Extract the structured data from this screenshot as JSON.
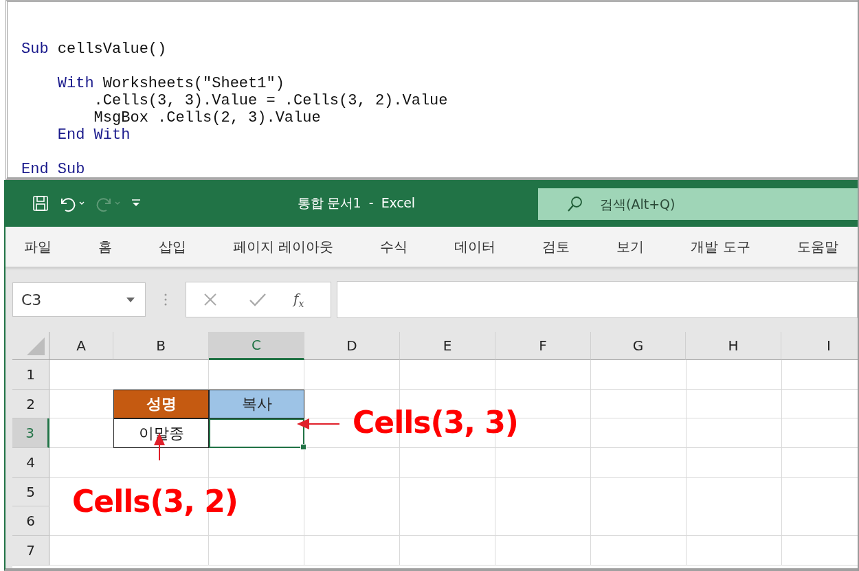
{
  "code_editor": {
    "lines": [
      {
        "kind": "code",
        "segments": [
          {
            "kind": "keyword",
            "text": "Sub"
          },
          {
            "kind": "plain",
            "text": " cellsValue()"
          }
        ]
      },
      {
        "kind": "blank"
      },
      {
        "kind": "code",
        "segments": [
          {
            "kind": "keyword",
            "text": "    With"
          },
          {
            "kind": "plain",
            "text": " Worksheets(\"Sheet1\")"
          }
        ]
      },
      {
        "kind": "code",
        "segments": [
          {
            "kind": "plain",
            "text": "        .Cells(3, 3).Value = .Cells(3, 2).Value"
          }
        ]
      },
      {
        "kind": "code",
        "segments": [
          {
            "kind": "plain",
            "text": "        MsgBox .Cells(2, 3).Value"
          }
        ]
      },
      {
        "kind": "code",
        "segments": [
          {
            "kind": "keyword",
            "text": "    End With"
          }
        ]
      },
      {
        "kind": "blank"
      },
      {
        "kind": "code",
        "segments": [
          {
            "kind": "keyword",
            "text": "End Sub"
          }
        ]
      }
    ]
  },
  "excel": {
    "title_bar": {
      "title": "통합 문서1  -  Excel",
      "search": {
        "placeholder": "검색(Alt+Q)"
      },
      "redo_disabled": true
    },
    "ribbon_tabs": [
      "파일",
      "홈",
      "삽입",
      "페이지 레이아웃",
      "수식",
      "데이터",
      "검토",
      "보기",
      "개발 도구",
      "도움말"
    ],
    "formula_bar": {
      "name_box": "C3",
      "function_label": "f$_{x}$"
    },
    "sheet": {
      "columns": [
        {
          "label": "A",
          "selected": false
        },
        {
          "label": "B",
          "selected": false
        },
        {
          "label": "C",
          "selected": true
        },
        {
          "label": "D",
          "selected": false
        },
        {
          "label": "E",
          "selected": false
        },
        {
          "label": "F",
          "selected": false
        },
        {
          "label": "G",
          "selected": false
        },
        {
          "label": "H",
          "selected": false
        },
        {
          "label": "I",
          "selected": false
        }
      ],
      "rows": [
        {
          "label": "1",
          "selected": false
        },
        {
          "label": "2",
          "selected": false,
          "cells": [
            {
              "kind": "empty"
            },
            {
              "kind": "header",
              "text": "성명",
              "color": "#c55a11"
            },
            {
              "kind": "header",
              "text": "복사",
              "color": "#9dc3e6"
            }
          ]
        },
        {
          "label": "3",
          "selected": true,
          "cells": [
            {
              "kind": "empty"
            },
            {
              "kind": "data",
              "text": "이말종"
            },
            {
              "kind": "active"
            }
          ]
        },
        {
          "label": "4",
          "selected": false
        },
        {
          "label": "5",
          "selected": false
        },
        {
          "label": "6",
          "selected": false
        },
        {
          "label": "7",
          "selected": false
        }
      ]
    },
    "annotations": [
      {
        "kind": "right",
        "text": "Cells(3, 3)"
      },
      {
        "kind": "below",
        "text": "Cells(3, 2)"
      }
    ]
  }
}
